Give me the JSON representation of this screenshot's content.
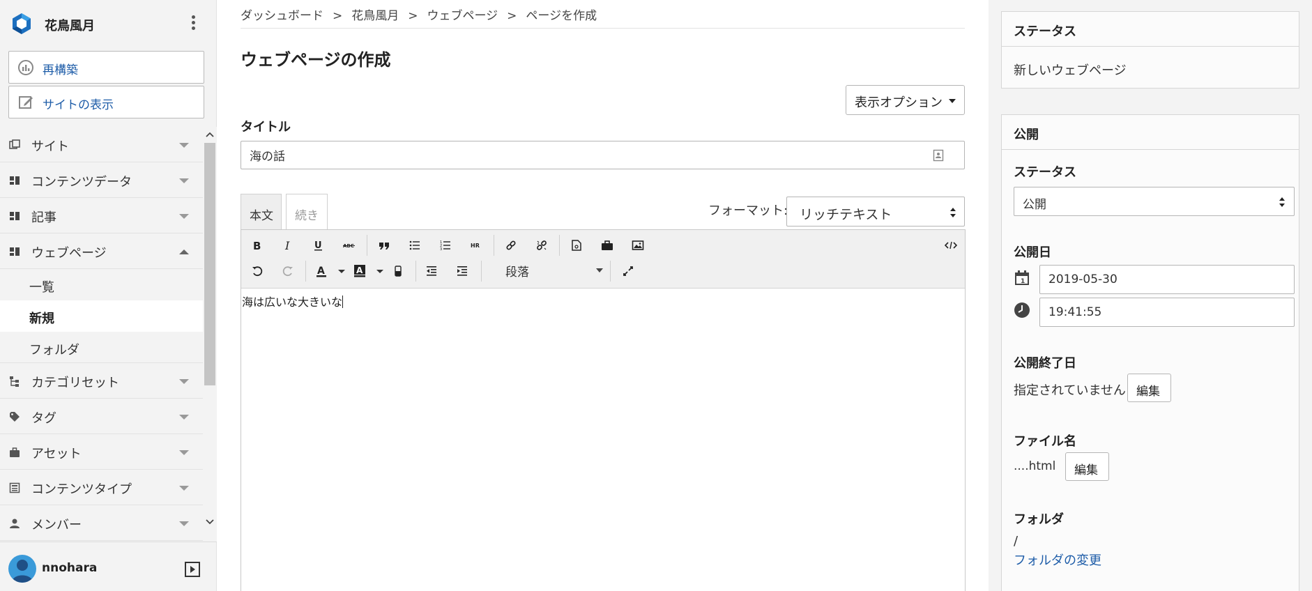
{
  "sidebar": {
    "brand": "花鳥風月",
    "rebuild_label": "再構築",
    "view_site_label": "サイトの表示",
    "nav": [
      "サイト",
      "コンテンツデータ",
      "記事",
      "ウェブページ"
    ],
    "subnav": [
      "一覧",
      "新規",
      "フォルダ"
    ],
    "nav_rest": [
      "カテゴリセット",
      "タグ",
      "アセット",
      "コンテンツタイプ",
      "メンバー"
    ],
    "user": "nnohara"
  },
  "breadcrumb": [
    "ダッシュボード",
    "花鳥風月",
    "ウェブページ",
    "ページを作成"
  ],
  "breadcrumb_sep": ">",
  "page_title": "ウェブページの作成",
  "display_options": "表示オプション",
  "title_field": {
    "label": "タイトル",
    "value": "海の話"
  },
  "tabs": [
    "本文",
    "続き"
  ],
  "format": {
    "label": "フォーマット:",
    "value": "リッチテキスト"
  },
  "editor": {
    "paragraph": "段落",
    "content": "海は広いな大きいな"
  },
  "status_card": {
    "title": "ステータス",
    "value": "新しいウェブページ"
  },
  "publish_card": {
    "title": "公開",
    "status_label": "ステータス",
    "status_value": "公開",
    "date_label": "公開日",
    "date": "2019-05-30",
    "time": "19:41:55",
    "end_label": "公開終了日",
    "end_value": "指定されていません",
    "edit_label": "編集",
    "filename_label": "ファイル名",
    "filename_value": "....html",
    "folder_label": "フォルダ",
    "folder_value": "/",
    "folder_change": "フォルダの変更"
  },
  "colors": {
    "link": "#1d5ca8",
    "sidebar_bg": "#f3f3f3",
    "brand_blue": "#1c6fbf"
  }
}
